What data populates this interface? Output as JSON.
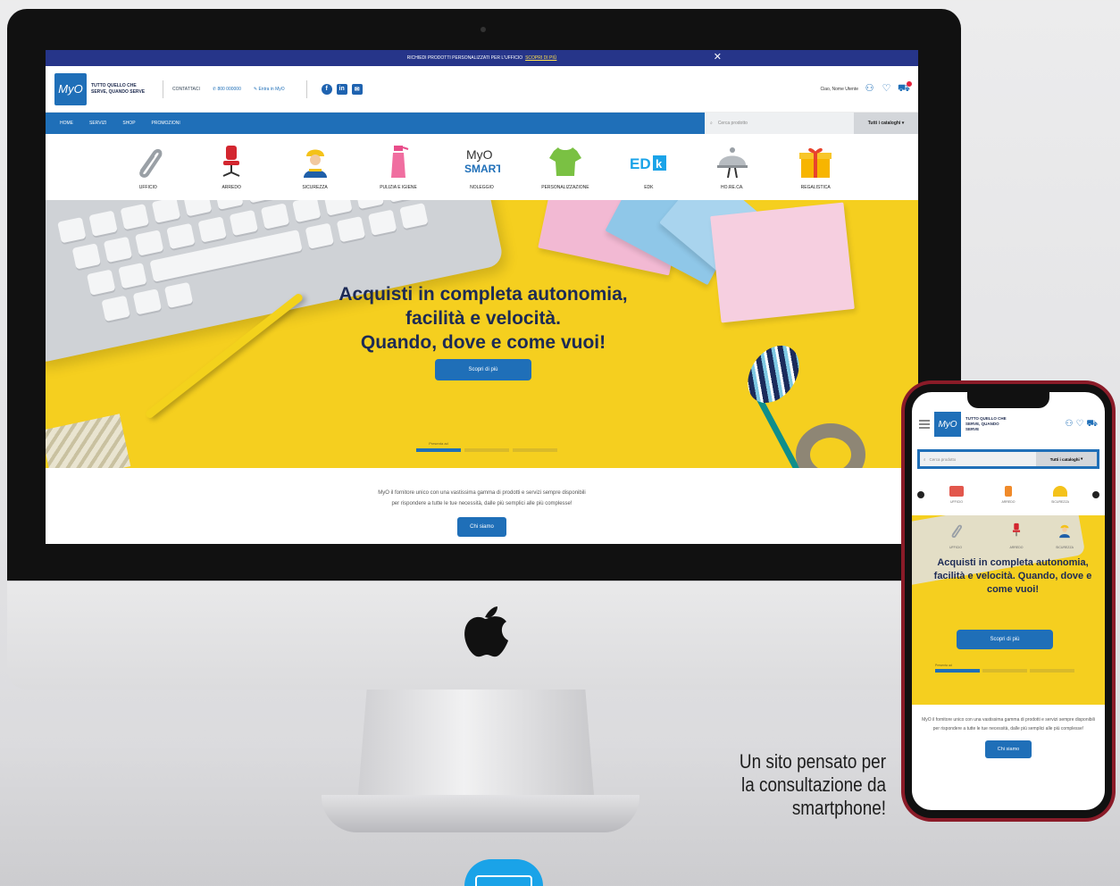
{
  "desktop_site": {
    "promo_bar": {
      "text": "RICHIEDI PRODOTTI PERSONALIZZATI PER L'UFFICIO",
      "link": "SCOPRI DI PIÙ"
    },
    "header": {
      "logo_text": "MyO",
      "tagline": "TUTTO QUELLO CHE SERVE, QUANDO SERVE",
      "links": [
        "CONTATTACI",
        "800 000000",
        "Entra in MyO"
      ],
      "greeting": "Ciao, Nome Utente"
    },
    "nav": {
      "items": [
        "HOME",
        "SERVIZI",
        "SHOP",
        "PROMOZIONI"
      ],
      "search_placeholder": "Cerca prodotto",
      "all_categories": "Tutti i cataloghi"
    },
    "categories": [
      {
        "label": "UFFICIO",
        "icon": "paperclip-icon"
      },
      {
        "label": "ARREDO",
        "icon": "office-chair-icon"
      },
      {
        "label": "SICUREZZA",
        "icon": "worker-icon"
      },
      {
        "label": "PULIZIA E IGIENE",
        "icon": "spray-bottle-icon"
      },
      {
        "label": "NOLEGGIO",
        "icon": "myo-smart-logo"
      },
      {
        "label": "PERSONALIZZAZIONE",
        "icon": "tshirt-icon"
      },
      {
        "label": "EDK",
        "icon": "edk-logo"
      },
      {
        "label": "HO.RE.CA.",
        "icon": "cloche-icon"
      },
      {
        "label": "REGALISTICA",
        "icon": "gift-icon"
      }
    ],
    "hero": {
      "line1": "Acquisti in completa autonomia,",
      "line2": "facilità e velocità.",
      "line3": "Quando, dove e come vuoi!",
      "button": "Scopri di più",
      "tabs": [
        "Presenta ad",
        "",
        ""
      ]
    },
    "about": {
      "line1": "MyO il fornitore unico con una vastissima gamma di prodotti e servizi sempre disponibili",
      "line2": "per rispondere a tutte le tue necessità, dalle più semplici alle più complesse!",
      "button": "Chi siamo"
    }
  },
  "phone_site": {
    "logo_text": "MyO",
    "tagline": "TUTTO QUELLO CHE SERVE, QUANDO SERVE",
    "search_placeholder": "Cerca prodotto",
    "all_categories": "Tutti i cataloghi",
    "top_categories": [
      "UFFICIO",
      "ARREDO",
      "SICUREZZA"
    ],
    "hero_categories": [
      "UFFICIO",
      "ARREDO",
      "SICUREZZA"
    ],
    "hero_text": "Acquisti in completa autonomia, facilità e velocità. Quando, dove e come vuoi!",
    "hero_button": "Scopri di più",
    "about_text": "MyO il fornitore unico con una vastissima gamma di prodotti e servizi sempre disponibili per rispondere a tutte le tue necessità, dalle più semplici alle più complesse!",
    "about_button": "Chi siamo"
  },
  "caption": {
    "line1": "Un sito pensato per",
    "line2": "la consultazione da",
    "line3": "smartphone!"
  },
  "colors": {
    "brand_blue": "#1f6fb8",
    "hero_yellow": "#f5cf1f",
    "promo_navy": "#263589"
  }
}
